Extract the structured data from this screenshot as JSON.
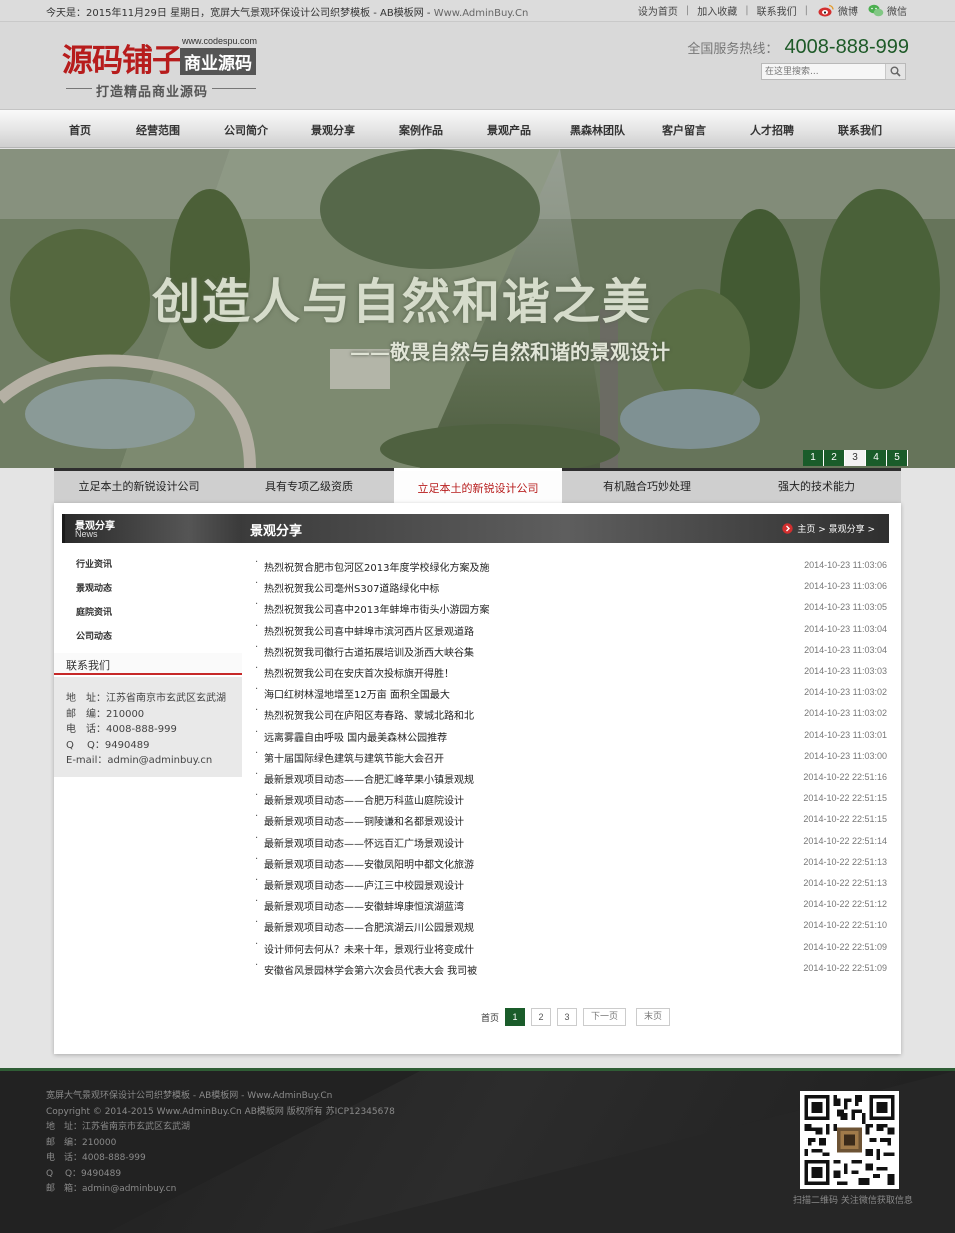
{
  "topbar": {
    "date_text": "今天是：2015年11月29日 星期日，宽屏大气景观环保设计公司织梦模板 - AB模板网 - ",
    "site_text": "Www.AdminBuy.Cn",
    "links": [
      "设为首页",
      "加入收藏",
      "联系我们"
    ],
    "weibo": "微博",
    "wechat": "微信"
  },
  "header": {
    "logo_main": "源码铺子",
    "logo_url": "www.codespu.com",
    "logo_badge": "商业源码",
    "logo_slogan": "打造精品商业源码",
    "hotline_label": "全国服务热线：",
    "hotline_number": "4008-888-999",
    "search_placeholder": "在这里搜索..."
  },
  "nav": [
    "首页",
    "经营范围",
    "公司简介",
    "景观分享",
    "案例作品",
    "景观产品",
    "黑森林团队",
    "客户留言",
    "人才招聘",
    "联系我们"
  ],
  "banner": {
    "headline": "创造人与自然和谐之美",
    "subline": "——敬畏自然与自然和谐的景观设计",
    "pages": [
      "1",
      "2",
      "3",
      "4",
      "5"
    ],
    "active_page": "3"
  },
  "features": {
    "items": [
      "立足本土的新锐设计公司",
      "具有专项乙级资质",
      "立足本土的新锐设计公司",
      "有机融合巧妙处理",
      "强大的技术能力"
    ],
    "active_index": 2
  },
  "sidebar": {
    "title": "景观分享",
    "subtitle": "News",
    "menu": [
      "行业资讯",
      "景观动态",
      "庭院资讯",
      "公司动态"
    ],
    "contact_title": "联系我们",
    "contact": [
      "地　址：江苏省南京市玄武区玄武湖",
      "邮　编：210000",
      "电　话：4008-888-999",
      "Q　 Q：9490489",
      "E-mail：admin@adminbuy.cn"
    ]
  },
  "content": {
    "title": "景观分享",
    "breadcrumb": "主页 > 景观分享 >",
    "news": [
      {
        "title": "热烈祝贺合肥市包河区2013年度学校绿化方案及施",
        "date": "2014-10-23 11:03:06"
      },
      {
        "title": "热烈祝贺我公司毫州S307道路绿化中标",
        "date": "2014-10-23 11:03:06"
      },
      {
        "title": "热烈祝贺我公司喜中2013年蚌埠市街头小游园方案",
        "date": "2014-10-23 11:03:05"
      },
      {
        "title": "热烈祝贺我公司喜中蚌埠市滨河西片区景观道路",
        "date": "2014-10-23 11:03:04"
      },
      {
        "title": "热烈祝贺我司徽行古道拓展培训及浙西大峡谷集",
        "date": "2014-10-23 11:03:04"
      },
      {
        "title": "热烈祝贺我公司在安庆首次投标旗开得胜！",
        "date": "2014-10-23 11:03:03"
      },
      {
        "title": "海口红树林湿地增至12万亩 面积全国最大",
        "date": "2014-10-23 11:03:02"
      },
      {
        "title": "热烈祝贺我公司在庐阳区寿春路、蒙城北路和北",
        "date": "2014-10-23 11:03:02"
      },
      {
        "title": "远离雾霾自由呼吸 国内最美森林公园推荐",
        "date": "2014-10-23 11:03:01"
      },
      {
        "title": "第十届国际绿色建筑与建筑节能大会召开",
        "date": "2014-10-23 11:03:00"
      },
      {
        "title": "最新景观项目动态——合肥汇峰苹果小镇景观规",
        "date": "2014-10-22 22:51:16"
      },
      {
        "title": "最新景观项目动态——合肥万科蓝山庭院设计",
        "date": "2014-10-22 22:51:15"
      },
      {
        "title": "最新景观项目动态——铜陵谦和名都景观设计",
        "date": "2014-10-22 22:51:15"
      },
      {
        "title": "最新景观项目动态——怀远百汇广场景观设计",
        "date": "2014-10-22 22:51:14"
      },
      {
        "title": "最新景观项目动态——安徽凤阳明中都文化旅游",
        "date": "2014-10-22 22:51:13"
      },
      {
        "title": "最新景观项目动态——庐江三中校园景观设计",
        "date": "2014-10-22 22:51:13"
      },
      {
        "title": "最新景观项目动态——安徽蚌埠康恒滨湖蓝湾",
        "date": "2014-10-22 22:51:12"
      },
      {
        "title": "最新景观项目动态——合肥滨湖云川公园景观规",
        "date": "2014-10-22 22:51:10"
      },
      {
        "title": "设计师何去何从？未来十年，景观行业将变成什",
        "date": "2014-10-22 22:51:09"
      },
      {
        "title": "安徽省风景园林学会第六次会员代表大会 我司被",
        "date": "2014-10-22 22:51:09"
      }
    ],
    "pagination": {
      "first": "首页",
      "pages": [
        "1",
        "2",
        "3"
      ],
      "active": "1",
      "next": "下一页",
      "last": "末页"
    }
  },
  "footer": {
    "lines": [
      "宽屏大气景观环保设计公司织梦模板 - AB模板网 - Www.AdminBuy.Cn",
      "Copyright © 2014-2015 Www.AdminBuy.Cn AB模板网 版权所有  苏ICP12345678",
      "地　址：江苏省南京市玄武区玄武湖",
      "邮　编：210000",
      "电　话：4008-888-999",
      "Q　 Q：9490489",
      "邮　箱：admin@adminbuy.cn"
    ],
    "qr_caption": "扫描二维码 关注微信获取信息"
  },
  "colors": {
    "brand_green": "#1a5c2a",
    "accent_red": "#b71c1c",
    "dark_bar": "#2e2e2e"
  }
}
